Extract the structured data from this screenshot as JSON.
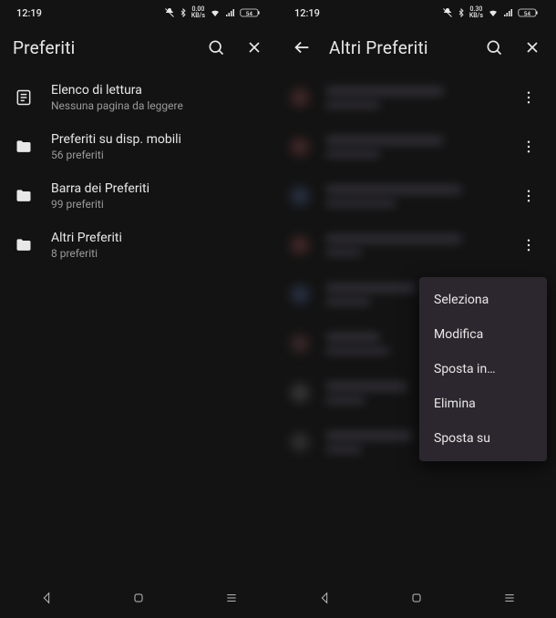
{
  "status": {
    "time": "12:19"
  },
  "left": {
    "title": "Preferiti",
    "items": [
      {
        "icon": "reading-list-icon",
        "title": "Elenco di lettura",
        "subtitle": "Nessuna pagina da leggere"
      },
      {
        "icon": "folder-icon",
        "title": "Preferiti su disp. mobili",
        "subtitle": "56 preferiti"
      },
      {
        "icon": "folder-icon",
        "title": "Barra dei Preferiti",
        "subtitle": "99 preferiti"
      },
      {
        "icon": "folder-icon",
        "title": "Altri Preferiti",
        "subtitle": "8 preferiti"
      }
    ]
  },
  "right": {
    "title": "Altri Preferiti",
    "items": [
      {
        "dot": "#6b3a3a",
        "w1": 130,
        "w2": 60
      },
      {
        "dot": "#6b3a3a",
        "w1": 130,
        "w2": 60
      },
      {
        "dot": "#3a4a6b",
        "w1": 150,
        "w2": 78
      },
      {
        "dot": "#6b3a3a",
        "w1": 150,
        "w2": 40
      },
      {
        "dot": "#3a4a6b",
        "w1": 100,
        "w2": 50
      },
      {
        "dot": "#5a3a3a",
        "w1": 60,
        "w2": 70
      },
      {
        "dot": "#555555",
        "w1": 90,
        "w2": 44
      },
      {
        "dot": "#4a4a4a",
        "w1": 96,
        "w2": 40
      }
    ],
    "menu": {
      "select": "Seleziona",
      "edit": "Modifica",
      "moveto": "Sposta in…",
      "delete": "Elimina",
      "moveup": "Sposta su"
    }
  }
}
